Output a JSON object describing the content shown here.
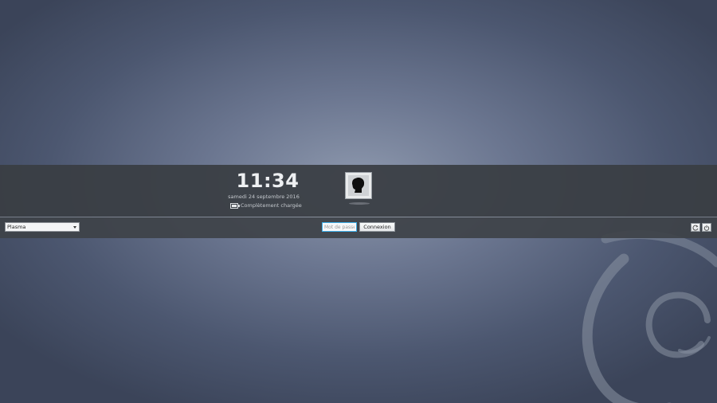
{
  "greeter": {
    "time": "11:34",
    "date": "samedi 24 septembre 2016",
    "battery_status": "Complètement chargée",
    "battery_icon": "battery-full-icon"
  },
  "user": {
    "avatar_icon": "user-silhouette-icon"
  },
  "session": {
    "selected": "Plasma"
  },
  "login": {
    "password_placeholder": "Mot de passe",
    "submit_label": "Connexion"
  },
  "power": {
    "buttons": [
      "restart-icon",
      "shutdown-icon"
    ]
  },
  "colors": {
    "accent_focus": "#3daee9",
    "panel": "#393d43"
  }
}
